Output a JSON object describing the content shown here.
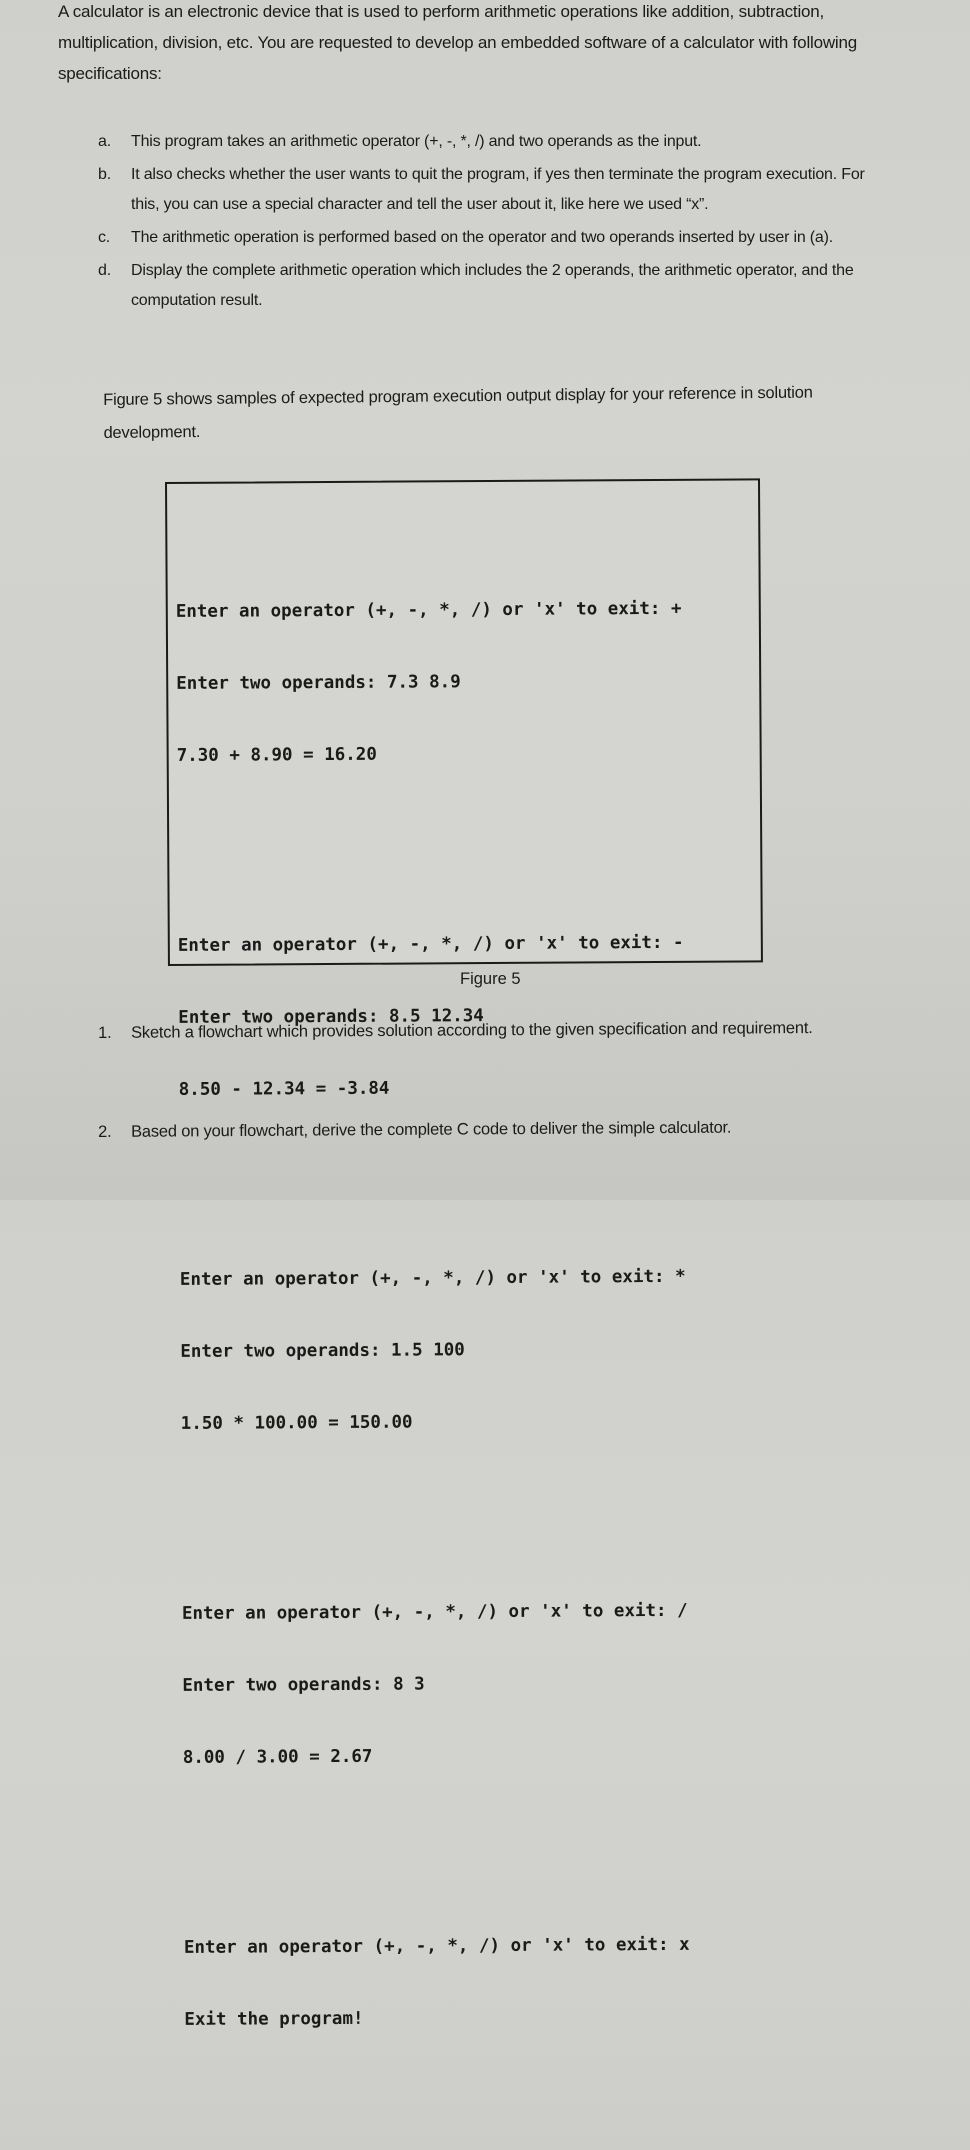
{
  "intro": {
    "text": "A calculator is an electronic device that is used to perform arithmetic operations like addition, subtraction, multiplication, division, etc. You are requested to develop an embedded software of a calculator with following specifications:"
  },
  "specifications": [
    {
      "marker": "a.",
      "text": "This program takes an arithmetic operator (+, -, *, /) and two operands as the input."
    },
    {
      "marker": "b.",
      "text": "It also checks whether the user wants to quit the program, if yes then terminate the program execution. For this, you can use a special character and tell the user about it, like here we used “x”."
    },
    {
      "marker": "c.",
      "text": "The arithmetic operation is performed based on the operator and two operands inserted by user in (a)."
    },
    {
      "marker": "d.",
      "text": "Display the complete arithmetic operation which includes the 2 operands, the arithmetic operator, and the computation result."
    }
  ],
  "figure_reference": "Figure 5 shows samples of expected program execution output display for your reference in solution development.",
  "figure": {
    "caption": "Figure 5",
    "console_blocks": [
      {
        "lines": [
          "Enter an operator (+, -, *, /) or 'x' to exit: +",
          "Enter two operands: 7.3 8.9",
          "7.30 + 8.90 = 16.20"
        ]
      },
      {
        "lines": [
          "Enter an operator (+, -, *, /) or 'x' to exit: -",
          "Enter two operands: 8.5 12.34",
          "8.50 - 12.34 = -3.84"
        ]
      },
      {
        "lines": [
          "Enter an operator (+, -, *, /) or 'x' to exit: *",
          "Enter two operands: 1.5 100",
          "1.50 * 100.00 = 150.00"
        ]
      },
      {
        "lines": [
          "Enter an operator (+, -, *, /) or 'x' to exit: /",
          "Enter two operands: 8 3",
          "8.00 / 3.00 = 2.67"
        ]
      },
      {
        "lines": [
          "Enter an operator (+, -, *, /) or 'x' to exit: x",
          "Exit the program!"
        ]
      }
    ]
  },
  "questions": [
    {
      "number": "1.",
      "text": "Sketch a flowchart which provides solution according to the given specification and requirement."
    },
    {
      "number": "2.",
      "text": "Based on your flowchart, derive the complete C code to deliver the simple calculator."
    }
  ]
}
